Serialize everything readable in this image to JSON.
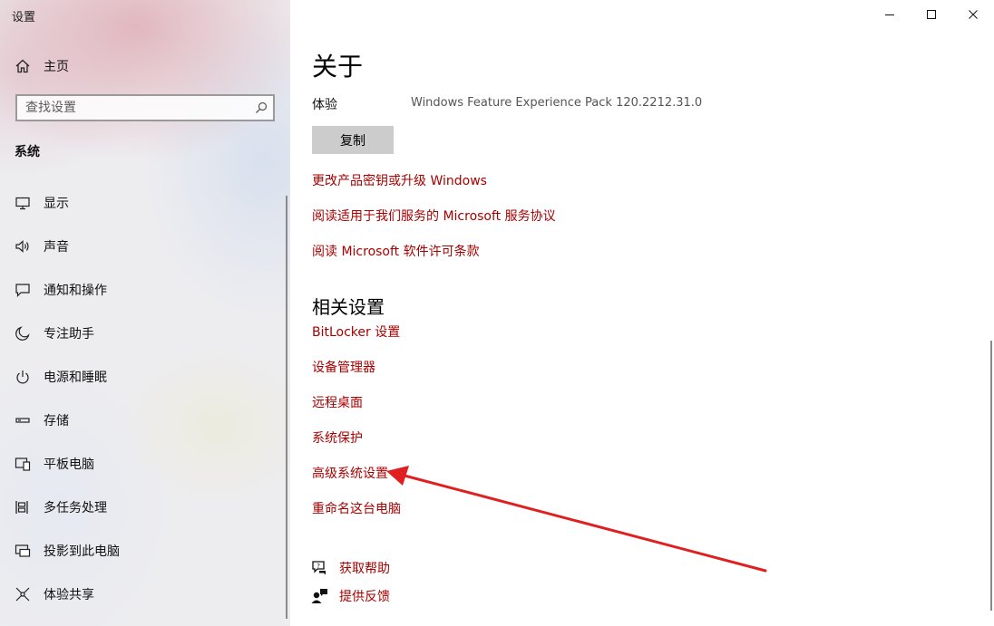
{
  "window": {
    "title": "设置"
  },
  "sidebar": {
    "home_label": "主页",
    "search_placeholder": "查找设置",
    "section_title": "系统",
    "items": [
      {
        "label": "显示",
        "icon": "display-icon"
      },
      {
        "label": "声音",
        "icon": "speaker-icon"
      },
      {
        "label": "通知和操作",
        "icon": "notification-icon"
      },
      {
        "label": "专注助手",
        "icon": "moon-icon"
      },
      {
        "label": "电源和睡眠",
        "icon": "power-icon"
      },
      {
        "label": "存储",
        "icon": "storage-icon"
      },
      {
        "label": "平板电脑",
        "icon": "tablet-icon"
      },
      {
        "label": "多任务处理",
        "icon": "multitasking-icon"
      },
      {
        "label": "投影到此电脑",
        "icon": "project-icon"
      },
      {
        "label": "体验共享",
        "icon": "share-icon"
      }
    ]
  },
  "main": {
    "title": "关于",
    "experience_label": "体验",
    "experience_value": "Windows Feature Experience Pack 120.2212.31.0",
    "copy_button": "复制",
    "links": [
      "更改产品密钥或升级 Windows",
      "阅读适用于我们服务的 Microsoft 服务协议",
      "阅读 Microsoft 软件许可条款"
    ],
    "related_title": "相关设置",
    "related_links": [
      "BitLocker 设置",
      "设备管理器",
      "远程桌面",
      "系统保护",
      "高级系统设置",
      "重命名这台电脑"
    ],
    "help_links": [
      {
        "label": "获取帮助",
        "icon": "help-chat-icon"
      },
      {
        "label": "提供反馈",
        "icon": "feedback-icon"
      }
    ]
  },
  "colors": {
    "link": "#a80000",
    "annotation": "#e02020",
    "button_bg": "#cccccc"
  }
}
